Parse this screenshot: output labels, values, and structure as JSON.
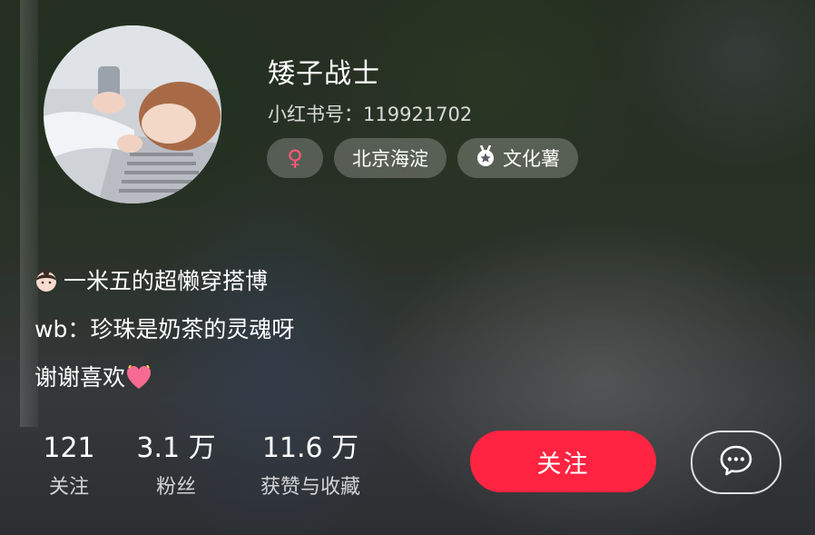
{
  "profile": {
    "nickname": "矮子战士",
    "red_id_label": "小红书号：",
    "red_id": "119921702",
    "tags": {
      "gender_symbol": "♀",
      "location": "北京海淀",
      "badge": "文化薯"
    },
    "bio": {
      "line1": "一米五的超懒穿搭博",
      "line2": "wb：珍珠是奶茶的灵魂呀",
      "line3": "谢谢喜欢"
    }
  },
  "stats": [
    {
      "value": "121",
      "label": "关注"
    },
    {
      "value": "3.1 万",
      "label": "粉丝"
    },
    {
      "value": "11.6 万",
      "label": "获赞与收藏"
    }
  ],
  "actions": {
    "follow_label": "关注",
    "chat_icon": "chat-bubble-icon"
  },
  "colors": {
    "accent": "#ff2442",
    "gender": "#ff5a79"
  }
}
